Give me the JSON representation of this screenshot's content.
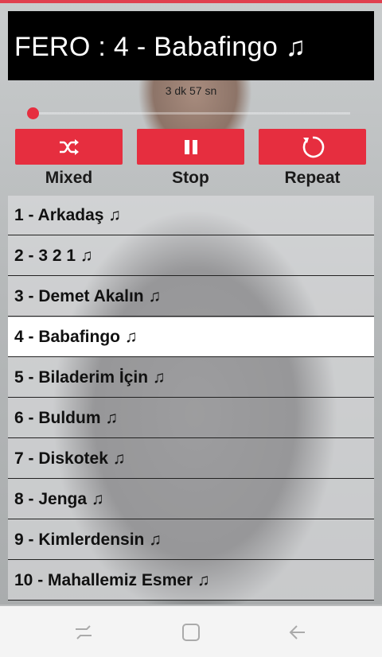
{
  "player": {
    "title": "FERO : 4 - Babafingo ♫",
    "duration": "3 dk 57 sn",
    "progress_fraction": 0.01
  },
  "controls": [
    {
      "name": "shuffle",
      "icon": "shuffle-icon",
      "label": "Mixed"
    },
    {
      "name": "stop",
      "icon": "pause-icon",
      "label": "Stop"
    },
    {
      "name": "repeat",
      "icon": "repeat-icon",
      "label": "Repeat"
    }
  ],
  "tracks": [
    "1 - Arkadaş ♫",
    "2 - 3 2 1 ♫",
    "3 - Demet Akalın ♫",
    "4 - Babafingo ♫",
    "5 - Biladerim İçin ♫",
    "6 - Buldum ♫",
    "7 - Diskotek ♫",
    "8 - Jenga ♫",
    "9 - Kimlerdensin ♫",
    "10 - Mahallemiz Esmer ♫"
  ],
  "active_track_index": 3,
  "colors": {
    "accent": "#e62e3f",
    "title_bg": "#000000",
    "active_row_bg": "#ffffff"
  },
  "navbar": {
    "icons": [
      "recent-apps-icon",
      "home-icon",
      "back-icon"
    ]
  }
}
